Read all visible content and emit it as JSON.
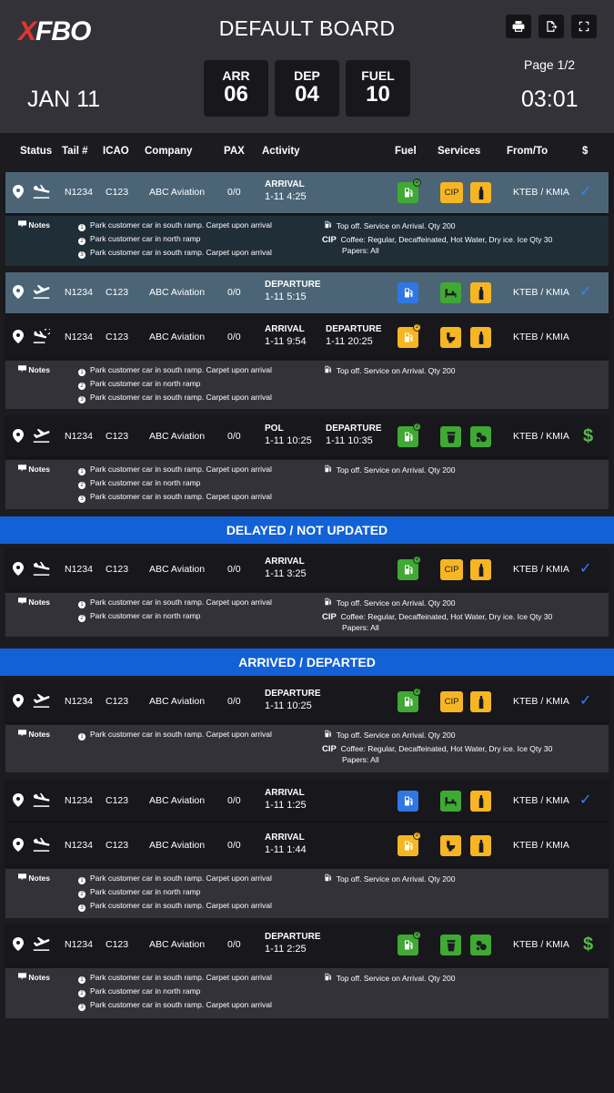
{
  "header": {
    "logo_a": "X",
    "logo_b": "FBO",
    "title": "DEFAULT BOARD",
    "date": "JAN 11",
    "page": "Page 1/2",
    "clock": "03:01",
    "counters": [
      {
        "label": "ARR",
        "value": "06"
      },
      {
        "label": "DEP",
        "value": "04"
      },
      {
        "label": "FUEL",
        "value": "10"
      }
    ]
  },
  "columns": {
    "status": "Status",
    "tail": "Tail #",
    "icao": "ICAO",
    "company": "Company",
    "pax": "PAX",
    "activity": "Activity",
    "fuel": "Fuel",
    "services": "Services",
    "fromto": "From/To",
    "pay": "$"
  },
  "sections": {
    "delayed": "DELAYED / NOT UPDATED",
    "arrived": "ARRIVED / DEPARTED"
  },
  "rows": [
    {
      "tail": "N1234",
      "icao": "C123",
      "company": "ABC Aviation",
      "pax": "0/0",
      "act1_type": "ARRIVAL",
      "act1_date": "1-11 4:25",
      "act2_type": "",
      "act2_date": "",
      "route": "KTEB / KMIA",
      "fuel": "green",
      "services": [
        "CIP",
        "bottle"
      ],
      "pay": "check",
      "status_icon": "landing-icon"
    },
    {
      "tail": "N1234",
      "icao": "C123",
      "company": "ABC Aviation",
      "pax": "0/0",
      "act1_type": "DEPARTURE",
      "act1_date": "1-11 5:15",
      "act2_type": "",
      "act2_date": "",
      "route": "KTEB / KMIA",
      "fuel": "blue",
      "services": [
        "car",
        "bottle"
      ],
      "pay": "check",
      "status_icon": "takeoff-icon"
    },
    {
      "tail": "N1234",
      "icao": "C123",
      "company": "ABC Aviation",
      "pax": "0/0",
      "act1_type": "ARRIVAL",
      "act1_date": "1-11 9:54",
      "act2_type": "DEPARTURE",
      "act2_date": "1-11 20:25",
      "route": "KTEB / KMIA",
      "fuel": "yellow",
      "services": [
        "toilet",
        "bottle"
      ],
      "pay": "",
      "status_icon": "turnaround-icon"
    },
    {
      "tail": "N1234",
      "icao": "C123",
      "company": "ABC Aviation",
      "pax": "0/0",
      "act1_type": "POL",
      "act1_date": "1-11 10:25",
      "act2_type": "DEPARTURE",
      "act2_date": "1-11 10:35",
      "route": "KTEB / KMIA",
      "fuel": "green",
      "services": [
        "cup",
        "cookie"
      ],
      "pay": "dollar",
      "status_icon": "takeoff-icon"
    },
    {
      "tail": "N1234",
      "icao": "C123",
      "company": "ABC Aviation",
      "pax": "0/0",
      "act1_type": "ARRIVAL",
      "act1_date": "1-11 3:25",
      "act2_type": "",
      "act2_date": "",
      "route": "KTEB / KMIA",
      "fuel": "green",
      "services": [
        "CIP",
        "bottle"
      ],
      "pay": "check",
      "status_icon": "landing-icon"
    },
    {
      "tail": "N1234",
      "icao": "C123",
      "company": "ABC Aviation",
      "pax": "0/0",
      "act1_type": "DEPARTURE",
      "act1_date": "1-11 10:25",
      "act2_type": "",
      "act2_date": "",
      "route": "KTEB / KMIA",
      "fuel": "green",
      "services": [
        "CIP",
        "bottle"
      ],
      "pay": "check",
      "status_icon": "takeoff-icon"
    },
    {
      "tail": "N1234",
      "icao": "C123",
      "company": "ABC Aviation",
      "pax": "0/0",
      "act1_type": "ARRIVAL",
      "act1_date": "1-11 1:25",
      "act2_type": "",
      "act2_date": "",
      "route": "KTEB / KMIA",
      "fuel": "blue",
      "services": [
        "car",
        "bottle"
      ],
      "pay": "check",
      "status_icon": "landing-icon"
    },
    {
      "tail": "N1234",
      "icao": "C123",
      "company": "ABC Aviation",
      "pax": "0/0",
      "act1_type": "ARRIVAL",
      "act1_date": "1-11 1:44",
      "act2_type": "",
      "act2_date": "",
      "route": "KTEB / KMIA",
      "fuel": "yellow",
      "services": [
        "toilet",
        "bottle"
      ],
      "pay": "",
      "status_icon": "landing-icon"
    },
    {
      "tail": "N1234",
      "icao": "C123",
      "company": "ABC Aviation",
      "pax": "0/0",
      "act1_type": "DEPARTURE",
      "act1_date": "1-11 2:25",
      "act2_type": "",
      "act2_date": "",
      "route": "KTEB / KMIA",
      "fuel": "green",
      "services": [
        "cup",
        "cookie"
      ],
      "pay": "dollar",
      "status_icon": "takeoff-icon"
    }
  ],
  "notes_label": "Notes",
  "note_texts": {
    "a": "Park customer car in south ramp. Carpet upon arrival",
    "b": "Park customer car in north ramp",
    "fuel": "Top off. Service on Arrival. Qty 200",
    "cip_label": "CIP",
    "cip_1": "Coffee: Regular, Decaffeinated, Hot Water, Dry ice. Ice Qty 30",
    "cip_2": "Papers: All"
  },
  "colors": {
    "green": "#3fa934",
    "yellow": "#f6b623",
    "blue": "#2f77e4",
    "section": "#1261d6",
    "check": "#3b82f6",
    "dollar": "#57b84a"
  }
}
